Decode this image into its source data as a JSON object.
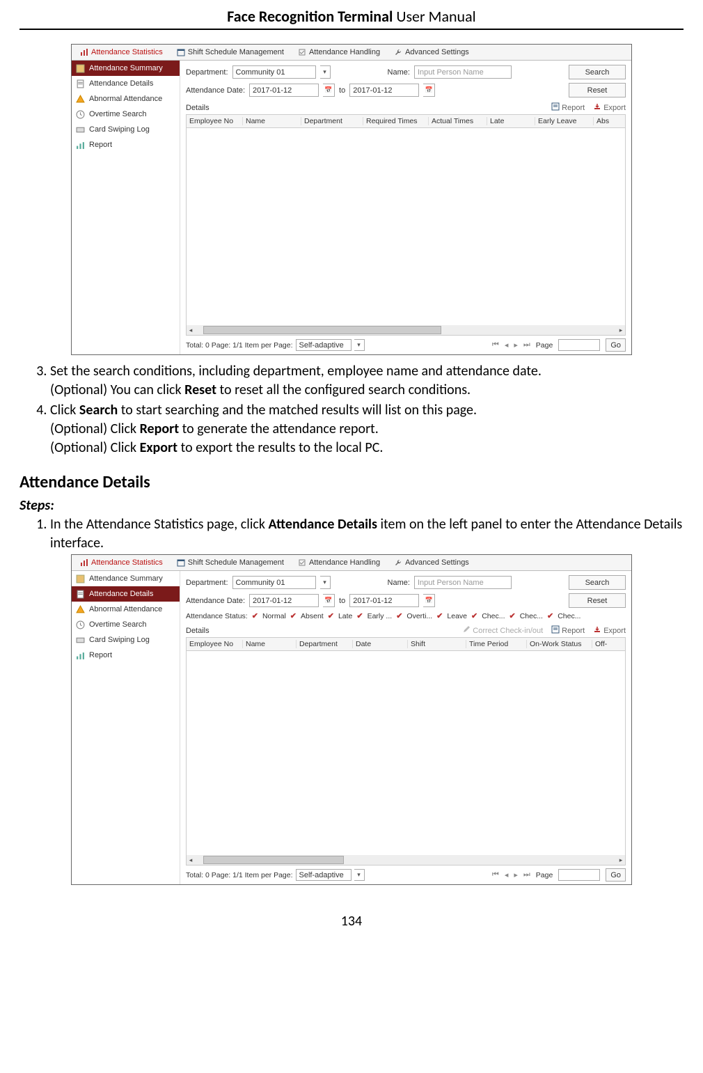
{
  "header": {
    "bold": "Face Recognition Terminal",
    "rest": "  User Manual"
  },
  "tabs": [
    "Attendance Statistics",
    "Shift Schedule Management",
    "Attendance Handling",
    "Advanced Settings"
  ],
  "sidebar": {
    "items": [
      "Attendance Summary",
      "Attendance Details",
      "Abnormal Attendance",
      "Overtime Search",
      "Card Swiping Log",
      "Report"
    ]
  },
  "form": {
    "dept_label": "Department:",
    "dept_value": "Community 01",
    "name_label": "Name:",
    "name_placeholder": "Input Person Name",
    "date_label": "Attendance Date:",
    "date_from": "2017-01-12",
    "date_to_label": "to",
    "date_to": "2017-01-12",
    "status_label": "Attendance Status:",
    "status_opts": [
      "Normal",
      "Absent",
      "Late",
      "Early ...",
      "Overti...",
      "Leave",
      "Chec...",
      "Chec...",
      "Chec..."
    ],
    "details_label": "Details",
    "correct_label": "Correct Check-in/out",
    "report_label": "Report",
    "export_label": "Export",
    "search_btn": "Search",
    "reset_btn": "Reset"
  },
  "table1_cols": [
    "Employee No",
    "Name",
    "Department",
    "Required Times",
    "Actual Times",
    "Late",
    "Early Leave",
    "Abs"
  ],
  "table2_cols": [
    "Employee No",
    "Name",
    "Department",
    "Date",
    "Shift",
    "Time Period",
    "On-Work Status",
    "Off-"
  ],
  "pager": {
    "total": "Total: 0   Page: 1/1   Item per Page:",
    "ipp": "Self-adaptive",
    "page_label": "Page",
    "go": "Go"
  },
  "body": {
    "li3a": "Set the search conditions, including department, employee name and attendance date.",
    "li3b_pre": "(Optional) You can click ",
    "li3b_bold": "Reset",
    "li3b_post": " to reset all the configured search conditions.",
    "li4a_pre": "Click ",
    "li4a_bold": "Search",
    "li4a_post": " to start searching and the matched results will list on this page.",
    "li4b_pre": "(Optional) Click ",
    "li4b_bold": "Report",
    "li4b_post": " to generate the attendance report.",
    "li4c_pre": "(Optional) Click ",
    "li4c_bold": "Export",
    "li4c_post": " to export the results to the local PC.",
    "h2": "Attendance Details",
    "steps": "Steps:",
    "li1_pre": "In the Attendance Statistics page, click ",
    "li1_bold": "Attendance Details",
    "li1_post": " item on the left panel to enter the Attendance Details interface."
  },
  "pagenum": "134"
}
